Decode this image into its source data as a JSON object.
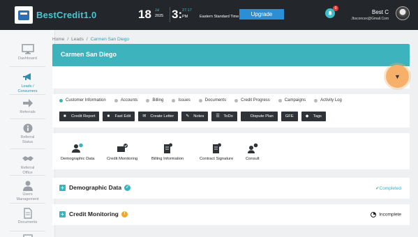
{
  "app": {
    "brand": "BestCredit1.0",
    "date_day": "18",
    "date_month": "Jul",
    "date_year": "2025",
    "time_hour": "3:",
    "time_min": "27:17",
    "time_ampm": "PM",
    "timezone": "Eastern Standard Time",
    "upgrade_label": "Upgrade",
    "notification_count": "0",
    "user_name": "Best C",
    "user_email": "Jbsconcex@Gmail.Com"
  },
  "sidebar": {
    "items": [
      {
        "label": "Dashboard"
      },
      {
        "label": "Leads / Consumers"
      },
      {
        "label": "Referrals"
      },
      {
        "label": "Referral Status"
      },
      {
        "label": "Referral Office"
      },
      {
        "label": "Users Management"
      },
      {
        "label": "Documents"
      }
    ]
  },
  "breadcrumb": {
    "home": "Home",
    "sep1": "/",
    "leads": "Leads",
    "sep2": "/",
    "current": "Carmen San Diego"
  },
  "header": {
    "title": "Carmen San Diego",
    "toggle_icon": "▼"
  },
  "tabs": [
    {
      "label": "Customer Information"
    },
    {
      "label": "Accounts"
    },
    {
      "label": "Billing"
    },
    {
      "label": "Issues"
    },
    {
      "label": "Documents"
    },
    {
      "label": "Credit Progress"
    },
    {
      "label": "Campaigns"
    },
    {
      "label": "Activity Log"
    }
  ],
  "actions": [
    {
      "label": "Credit Report",
      "icon": "file-icon"
    },
    {
      "label": "Fast Edit",
      "icon": "file-icon"
    },
    {
      "label": "Create Letter",
      "icon": "envelope-icon"
    },
    {
      "label": "Notes",
      "icon": "edit-icon"
    },
    {
      "label": "ToDo",
      "icon": "list-icon"
    },
    {
      "label": "Dispute Plan",
      "icon": "plan-icon"
    },
    {
      "label": "GFE",
      "icon": ""
    },
    {
      "label": "Tags",
      "icon": "tag-icon"
    }
  ],
  "cards": [
    {
      "label": "Demographic Data"
    },
    {
      "label": "Credit Monitoring"
    },
    {
      "label": "Billing Information"
    },
    {
      "label": "Contract Signature"
    },
    {
      "label": "Consult"
    }
  ],
  "sections": [
    {
      "title": "Demographic Data",
      "badge": "✓",
      "status": "✔Completed"
    },
    {
      "title": "Credit Monitoring",
      "badge": "!",
      "status": "Incomplete"
    }
  ],
  "colors": {
    "accent": "#3db3bd",
    "topbar": "#23262b",
    "upgrade": "#2c8fd6",
    "toggle": "#f6b06a"
  }
}
